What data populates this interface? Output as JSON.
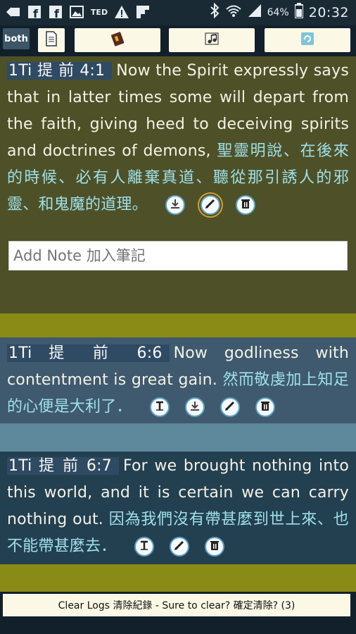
{
  "status_bar": {
    "battery_pct": "64%",
    "time": "20:32",
    "left_icons": [
      "back-arrow-icon",
      "facebook-icon",
      "facebook-icon",
      "image-icon",
      "ted-icon",
      "warning-icon",
      "flipboard-icon"
    ],
    "right_icons": [
      "bluetooth-icon",
      "wifi-icon",
      "signal-icon",
      "battery-icon"
    ],
    "ted_label": "TED"
  },
  "toolbar": {
    "both_label": "both",
    "buttons": [
      "document-icon",
      "bible-book-icon",
      "music-note-icon",
      "refresh-icon"
    ]
  },
  "entries": [
    {
      "ref": "1Ti 提 前 4:1",
      "en": "Now the Spirit expressly says that in latter times some will depart from the faith, giving heed to deceiving spirits and doctrines of demons,",
      "zh": "聖靈明說、在後來的時候、必有人離棄真道、聽從那引誘人的邪靈、和鬼魔的道理。",
      "actions": [
        "download-icon",
        "pencil-icon",
        "trash-icon"
      ],
      "note_placeholder": "Add Note 加入筆記"
    },
    {
      "ref": "1Ti  提  前  6:6",
      "en": "Now godliness with contentment is great gain.",
      "zh": "然而敬虔加上知足的心便是大利了．",
      "actions": [
        "text-icon",
        "download-icon",
        "pencil-icon",
        "trash-icon"
      ]
    },
    {
      "ref": "1Ti 提 前 6:7",
      "en": "For we brought nothing into this world, and it is certain we can carry nothing out.",
      "zh": "因為我們沒有帶甚麼到世上來、也不能帶甚麼去．",
      "actions": [
        "text-icon",
        "pencil-icon",
        "trash-icon"
      ]
    }
  ],
  "footer": {
    "clear_label": "Clear Logs 清除紀錄 - Sure to clear? 確定清除? (3)"
  },
  "colors": {
    "entry1_bg": "#4e5127",
    "entry2_bg": "#3f5a6e",
    "entry3_bg": "#234050",
    "separator_olive": "#898b16",
    "chinese_text": "#9fe0ea"
  }
}
